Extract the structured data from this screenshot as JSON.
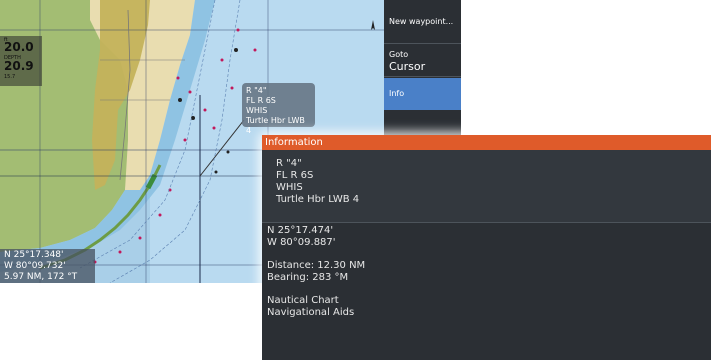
{
  "depth": {
    "value1": "20.0",
    "unit1": "ft",
    "label2": "DEPTH",
    "value2": "20.9",
    "sub": "15.7"
  },
  "cursor_position": {
    "lat": "N  25°17.348'",
    "lon": "W  80°09.732'",
    "range": "5.97 NM, 172 °T"
  },
  "popup": {
    "lines": [
      "R \"4\"",
      "FL R 6S",
      "WHIS",
      "Turtle Hbr LWB 4"
    ]
  },
  "menu": {
    "new_waypoint": "New waypoint...",
    "goto_line1": "Goto",
    "goto_line2": "Cursor",
    "info": "Info"
  },
  "info_panel": {
    "title": "Information",
    "name_lines": [
      "R \"4\"",
      "FL R 6S",
      "WHIS",
      "Turtle Hbr LWB 4"
    ],
    "lat": "N  25°17.474'",
    "lon": "W  80°09.887'",
    "distance": "Distance: 12.30 NM",
    "bearing": "Bearing: 283 °M",
    "source1": "Nautical Chart",
    "source2": "Navigational Aids"
  },
  "colors": {
    "water": "#a9cfe8",
    "land_green": "#a3bd73",
    "urban": "#c4b25b",
    "header_orange": "#df5b2a",
    "menu_bg": "#2b2f34",
    "menu_selected": "#4a80c8"
  }
}
